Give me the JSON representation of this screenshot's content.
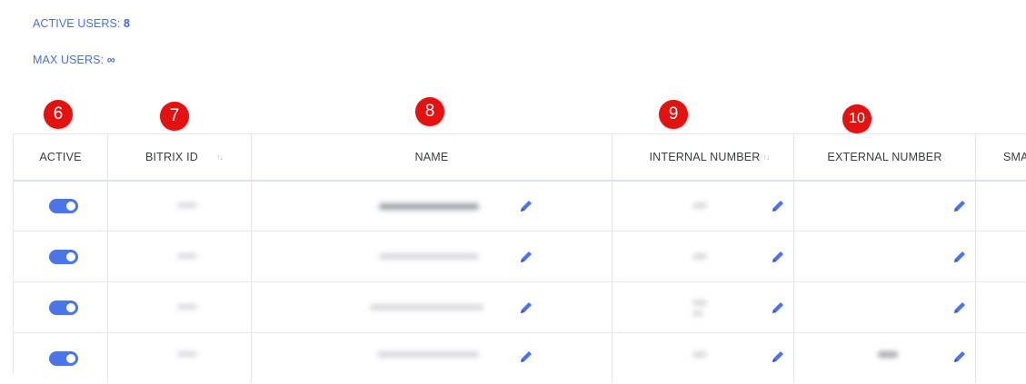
{
  "stats": {
    "active_label": "ACTIVE USERS:",
    "active_value": "8",
    "max_label": "MAX USERS:",
    "max_value": "∞"
  },
  "badges": [
    "6",
    "7",
    "8",
    "9",
    "10"
  ],
  "columns": {
    "active": "ACTIVE",
    "bitrix_id": "BITRIX ID",
    "name": "NAME",
    "internal": "INTERNAL NUMBER",
    "external": "EXTERNAL NUMBER",
    "sma": "SMA"
  },
  "sort_glyph": "↑↓",
  "rows": [
    {
      "active": true
    },
    {
      "active": true
    },
    {
      "active": true
    },
    {
      "active": true
    }
  ],
  "colors": {
    "accent": "#4a72d8",
    "toggle": "#4d73e8",
    "badge": "#e41111"
  }
}
